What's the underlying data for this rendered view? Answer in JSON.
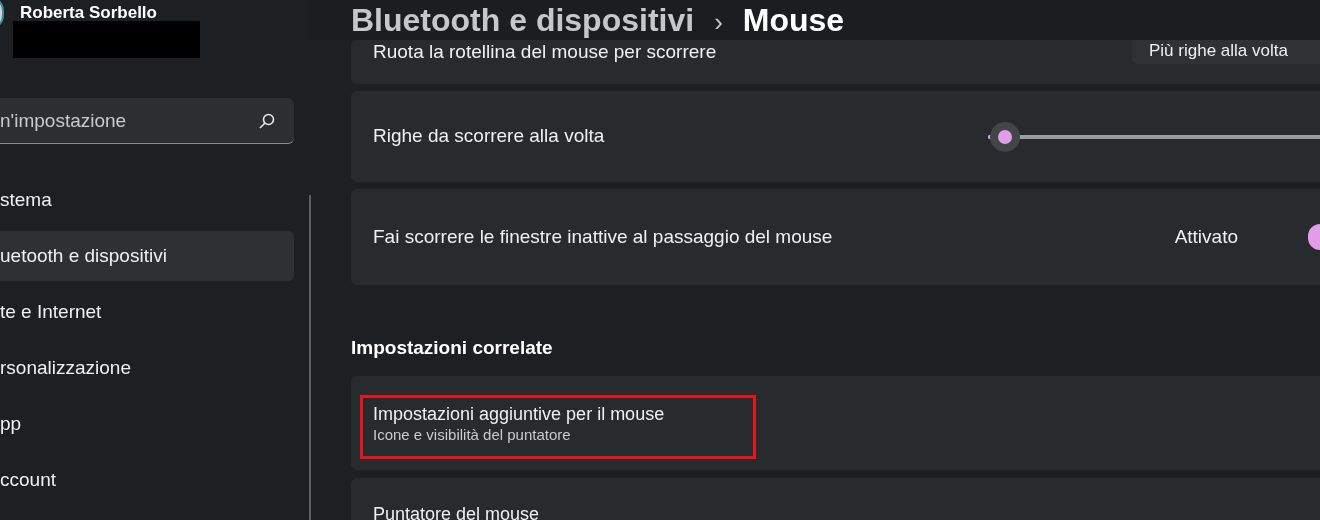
{
  "user": {
    "name": "Roberta Sorbello"
  },
  "search": {
    "placeholder": "n'impostazione"
  },
  "nav": [
    {
      "label": "stema",
      "selected": false
    },
    {
      "label": "uetooth e dispositivi",
      "selected": true
    },
    {
      "label": "te e Internet",
      "selected": false
    },
    {
      "label": "rsonalizzazione",
      "selected": false
    },
    {
      "label": "pp",
      "selected": false
    },
    {
      "label": "ccount",
      "selected": false
    }
  ],
  "breadcrumb": {
    "parent": "Bluetooth e dispositivi",
    "separator": "›",
    "current": "Mouse"
  },
  "settings": [
    {
      "kind": "dropdown",
      "label": "Ruota la rotellina del mouse per scorrere",
      "value": "Più righe alla volta"
    },
    {
      "kind": "slider",
      "label": "Righe da scorrere alla volta",
      "level": 0.05
    },
    {
      "kind": "toggle",
      "label": "Fai scorrere le finestre inattive al passaggio del mouse",
      "state_text": "Attivato",
      "on": true
    }
  ],
  "related": {
    "heading": "Impostazioni correlate",
    "items": [
      {
        "title": "Impostazioni aggiuntive per il mouse",
        "subtitle": "Icone e visibilità del puntatore",
        "highlighted": true
      },
      {
        "title": "Puntatore del mouse",
        "highlighted": false
      }
    ]
  }
}
